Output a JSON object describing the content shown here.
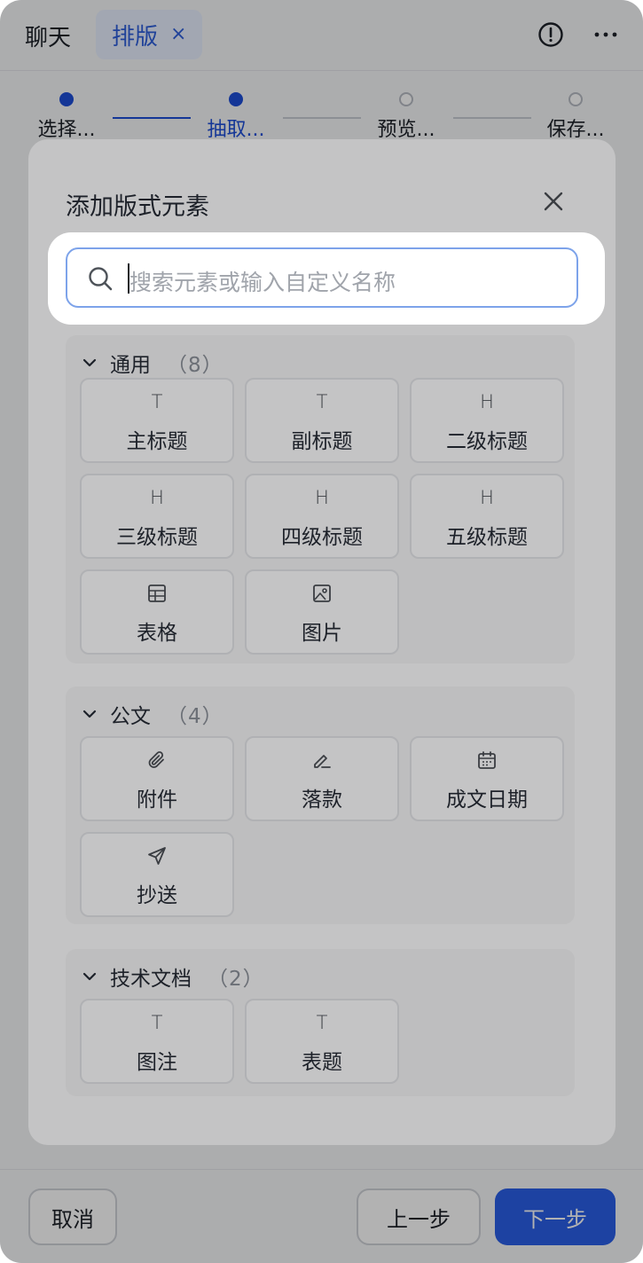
{
  "topbar": {
    "tabs": [
      {
        "label": "聊天"
      },
      {
        "label": "排版",
        "close": "×"
      }
    ],
    "icons": [
      "info-icon",
      "more-icon"
    ]
  },
  "steps": [
    {
      "label": "选择...",
      "state": "done"
    },
    {
      "label": "抽取...",
      "state": "active"
    },
    {
      "label": "预览...",
      "state": "todo"
    },
    {
      "label": "保存...",
      "state": "todo"
    }
  ],
  "footer": {
    "cancel": "取消",
    "prev": "上一步",
    "next": "下一步"
  },
  "colors": {
    "accent": "#2a5fe8",
    "step_active": "#1d4ed8",
    "search_border": "#7da3ea"
  },
  "modal": {
    "title": "添加版式元素",
    "close_icon": "close-icon",
    "search": {
      "placeholder": "搜索元素或输入自定义名称"
    },
    "sections": [
      {
        "title": "通用",
        "count": "（8）",
        "items": [
          {
            "label": "主标题",
            "icon": "T"
          },
          {
            "label": "副标题",
            "icon": "T"
          },
          {
            "label": "二级标题",
            "icon": "H"
          },
          {
            "label": "三级标题",
            "icon": "H"
          },
          {
            "label": "四级标题",
            "icon": "H"
          },
          {
            "label": "五级标题",
            "icon": "H"
          },
          {
            "label": "表格",
            "icon": "table-icon"
          },
          {
            "label": "图片",
            "icon": "image-icon"
          }
        ]
      },
      {
        "title": "公文",
        "count": "（4）",
        "items": [
          {
            "label": "附件",
            "icon": "paperclip-icon"
          },
          {
            "label": "落款",
            "icon": "pen-icon"
          },
          {
            "label": "成文日期",
            "icon": "calendar-icon"
          },
          {
            "label": "抄送",
            "icon": "send-icon"
          }
        ]
      },
      {
        "title": "技术文档",
        "count": "（2）",
        "items": [
          {
            "label": "图注",
            "icon": "T"
          },
          {
            "label": "表题",
            "icon": "T"
          }
        ]
      }
    ]
  }
}
